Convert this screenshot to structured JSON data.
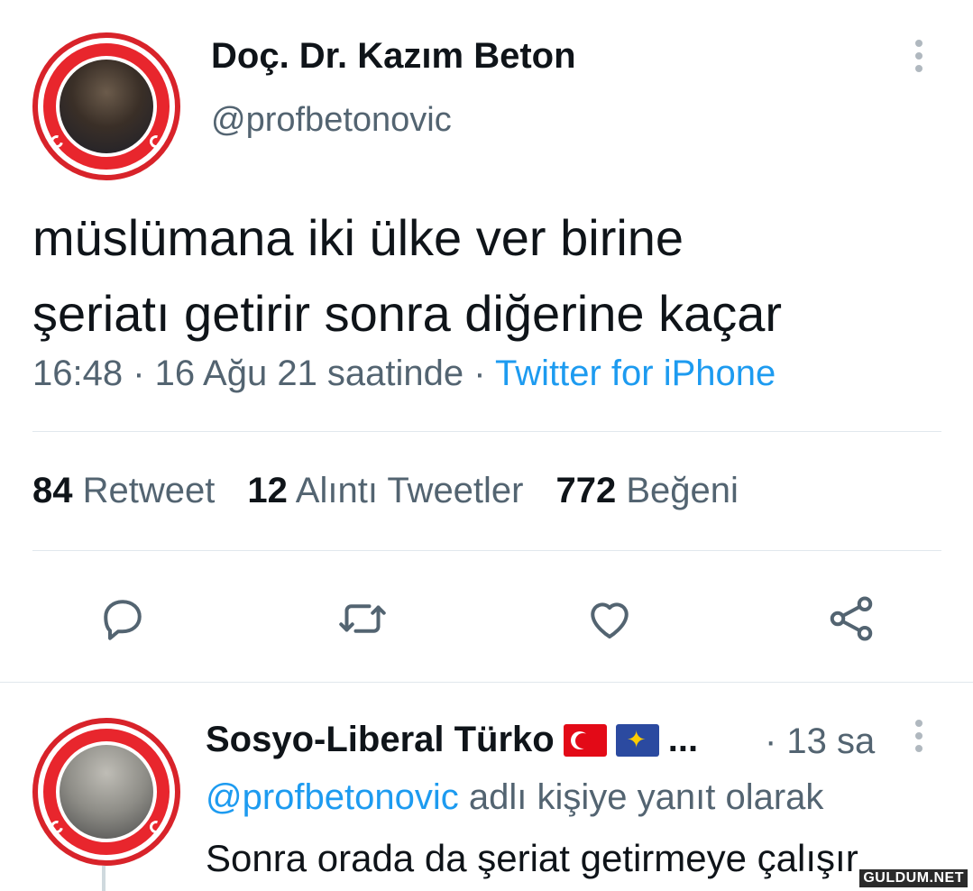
{
  "tweet": {
    "author_name": "Doç. Dr. Kazım Beton",
    "author_handle": "@profbetonovic",
    "text_line1": "müslümana iki ülke ver birine",
    "text_line2": "şeriatı getirir sonra diğerine kaçar",
    "timestamp": "16:48 · 16 Ağu 21 saatinde · ",
    "source": "Twitter for iPhone"
  },
  "stats": {
    "retweet_count": "84",
    "retweet_label": "Retweet",
    "quote_count": "12",
    "quote_label": "Alıntı Tweetler",
    "like_count": "772",
    "like_label": "Beğeni"
  },
  "actions": [
    "reply-icon",
    "retweet-icon",
    "like-icon",
    "share-icon"
  ],
  "reply": {
    "author_name": "Sosyo-Liberal Türko",
    "ellipsis": "...",
    "time": "· 13 sa",
    "replying_mention": "@profbetonovic",
    "replying_suffix": " adlı kişiye yanıt olarak",
    "text": "Sonra orada da şeriat getirmeye çalışır"
  },
  "watermark": "GULDUM.NET",
  "colors": {
    "accent": "#1d9bf0",
    "secondary_text": "#536471",
    "primary_text": "#0f1419",
    "avatar_ring": "#d8232a"
  }
}
